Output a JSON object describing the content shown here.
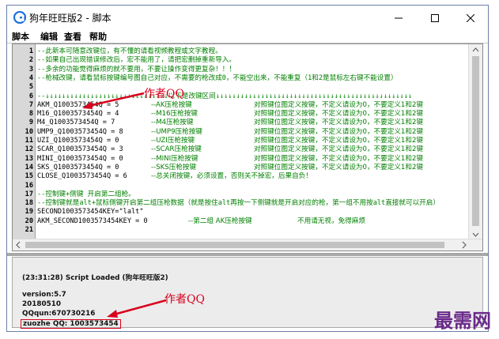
{
  "window": {
    "title": "狗年旺旺版2 - 脚本"
  },
  "menu": [
    "脚本",
    "编辑",
    "查看",
    "帮助"
  ],
  "editor": {
    "lines": [
      {
        "n": "1",
        "text": "--此新本可随意改键位，有不懂的请看视频教程或文字教程。",
        "kind": "comment"
      },
      {
        "n": "2",
        "text": "--如果自己出现错误修改后，宏不能用了，请把宏删掉重新导入。",
        "kind": "comment"
      },
      {
        "n": "3",
        "text": "--多余的功能觉得麻烦的就不要用，不要让操作变得更复杂！！！",
        "kind": "comment"
      },
      {
        "n": "4",
        "text": "--枪械改键，请看鼠标按键编号图自己对应，不需要的枪改成0，不能空出来，不能重复（1和2是鼠标左右键不能设置）",
        "kind": "comment"
      },
      {
        "n": "5",
        "text": "",
        "kind": "comment"
      },
      {
        "n": "6",
        "text": "--↓↓↓↓↓↓↓↓↓↓↓↓↓↓↓↓↓↓↓↓↓↓↓↓↓↓↓↓↓↓以下是改键区间↓↓↓↓↓↓↓↓↓↓↓↓↓↓↓↓↓↓↓↓↓↓↓↓↓↓↓↓↓↓↓↓↓↓↓↓↓↓↓↓↓↓↓↓↓↓↓↓",
        "kind": "comment"
      },
      {
        "n": "7",
        "text": "AKM_Q1003573454Q = 5",
        "kind": "code",
        "c2": "--AK压枪按键",
        "c3": "对照键位图定义按键，不定义请设为0，不要定义1和2键"
      },
      {
        "n": "8",
        "text": "M16_Q1003573454Q = 4",
        "kind": "code",
        "c2": "--M16压枪按键",
        "c3": "对照键位图定义按键，不定义请设为0，不要定义1和2键"
      },
      {
        "n": "9",
        "text": "M4_Q1003573454Q = 7",
        "kind": "code",
        "c2": "--M4压枪按键",
        "c3": "对照键位图定义按键，不定义请设为0，不要定义1和2键"
      },
      {
        "n": "10",
        "text": "UMP9_Q1003573454Q = 8",
        "kind": "code",
        "c2": "--UMP9压枪按键",
        "c3": "对照键位图定义按键，不定义请设为0，不要定义1和2键"
      },
      {
        "n": "11",
        "text": "UZI_Q1003573454Q = 0",
        "kind": "code",
        "c2": "--UZI压枪按键",
        "c3": "对照键位图定义按键，不定义请设为0，不要定义1和2键"
      },
      {
        "n": "12",
        "text": "SCAR_Q1003573454Q = 3",
        "kind": "code",
        "c2": "--SCAR压枪按键",
        "c3": "对照键位图定义按键，不定义请设为0，不要定义1和2键"
      },
      {
        "n": "13",
        "text": "MINI_Q1003573454Q = 0",
        "kind": "code",
        "c2": "--MINI压枪按键",
        "c3": "对照键位图定义按键，不定义请设为0，不要定义1和2键"
      },
      {
        "n": "14",
        "text": "SKS_Q1003573454Q = 0",
        "kind": "code",
        "c2": "--SKS压枪按键",
        "c3": "对照键位图定义按键，不定义请设为0，不要定义1和2键"
      },
      {
        "n": "15",
        "text": "CLOSE_Q1003573454Q = 6",
        "kind": "code",
        "c2": "--总关闭按键，必须设置，否则关不掉宏，后果自负！",
        "c3": ""
      },
      {
        "n": "16",
        "text": "",
        "kind": "comment"
      },
      {
        "n": "17",
        "text": "--控制键+侧键 开启第二组枪。",
        "kind": "comment"
      },
      {
        "n": "18",
        "text": "--控制键就是alt+鼠标侧键开启第二组压枪数据（就是按住alt再按一下侧键就是开启对应的枪，第一组不用按alt直接就可以开启）",
        "kind": "comment"
      },
      {
        "n": "19",
        "text": "SECOND1003573454KEY=\"lalt\"",
        "kind": "code"
      },
      {
        "n": "20",
        "text": "AKM_SECOND1003573454KEY = 0",
        "kind": "code",
        "c2": "",
        "c3": ""
      },
      {
        "n": "21",
        "text": "",
        "kind": "comment"
      }
    ],
    "line20_extra": "--第二组 AK压枪按键",
    "line20_extra2": "不用请无视，免得麻烦"
  },
  "output": {
    "lines": [
      "(23:31:28) Script Loaded (狗年旺旺版2)",
      "version:5.7",
      "20180510",
      "QQqun:670730216",
      "zuozhe QQ: 1003573454"
    ]
  },
  "annotations": {
    "top": "作者QQ",
    "bottom": "作者QQ"
  },
  "watermark": "最需网",
  "colors": {
    "comment": "#008000",
    "annotation": "#d8001c",
    "watermark": "#6a2a8a"
  }
}
